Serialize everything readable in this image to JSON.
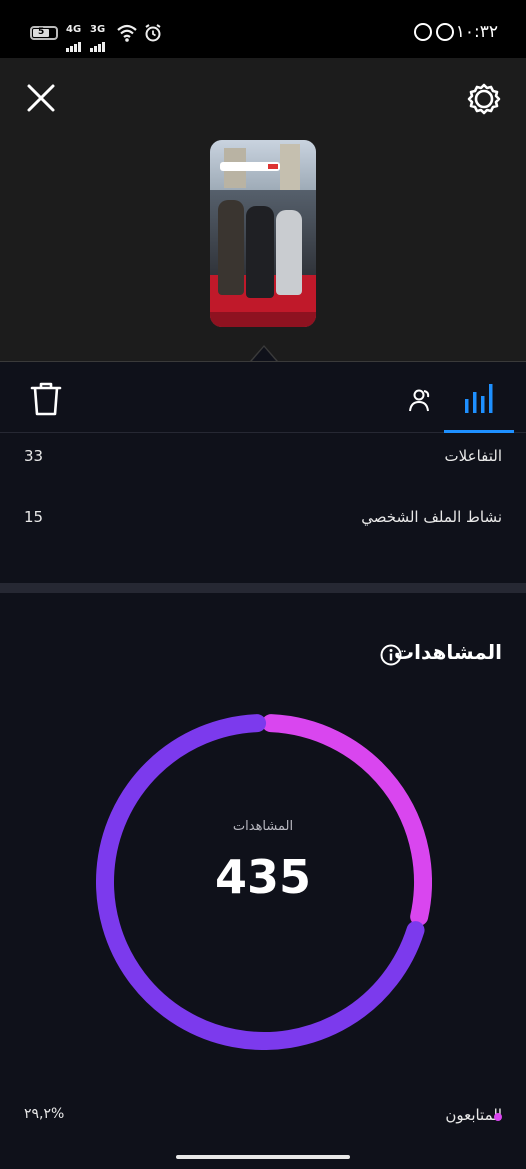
{
  "status_bar": {
    "battery": "5",
    "net1": "4G",
    "net2": "3G",
    "time": "١٠:٣٢"
  },
  "toolbar": {
    "tabs": [
      "bar-chart",
      "people"
    ]
  },
  "metrics": [
    {
      "label": "التفاعلات",
      "value": "33"
    },
    {
      "label": "نشاط الملف الشخصي",
      "value": "15"
    }
  ],
  "views_section": {
    "title": "المشاهدات",
    "chart_label": "المشاهدات",
    "total": "435",
    "legend_label": "المتابعون",
    "legend_percent": "٢٩,٢%"
  },
  "colors": {
    "accent_blue": "#1e90ff",
    "followers": "#d946ef",
    "non_followers": "#7c3aed"
  },
  "chart_data": {
    "type": "pie",
    "total": 435,
    "series": [
      {
        "name": "المتابعون",
        "percent": 29.2
      },
      {
        "percent": 70.8
      }
    ]
  }
}
